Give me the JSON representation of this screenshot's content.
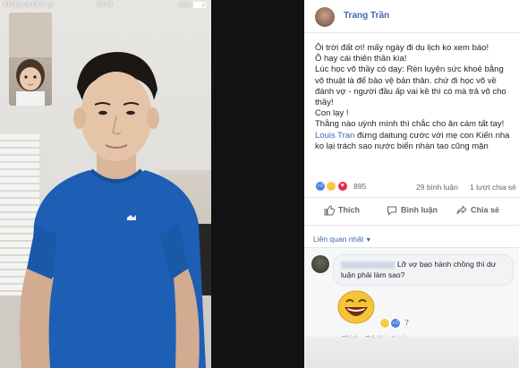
{
  "phone": {
    "carrier": "Không có Dịch vụ",
    "time": "09:46",
    "battery": "80%"
  },
  "post": {
    "author": "Trang Trần",
    "lines": [
      "Ôi trời đất ơi! mấy ngày đi du lịch ko xem báo!",
      "Ô hay cái thiên thần kìa!",
      "Lúc học võ thầy có dạy: Rèn luyện sức khoẻ bằng võ thuật là để bảo vệ bản thân. chứ đi học võ về đánh vợ - người đầu ấp vai kề thì có mà trả võ cho thầy!",
      "Con lạy !",
      "Thằng nào uỳnh mình thì chắc cho ăn cám tất tay!"
    ],
    "mention": "Louis Tran",
    "mention_rest": " đừng daitung cước với mẹ con Kiến nha ko lại trách sao nước biển nhàn tao cũng mặn",
    "reaction_count": "895",
    "comment_count": "29 bình luận",
    "share_count": "1 lượt chia sẻ",
    "actions": {
      "like": "Thích",
      "comment": "Bình luận",
      "share": "Chia sẻ"
    },
    "related_label": "Liên quan nhất"
  },
  "comment": {
    "text": "Lỡ vợ bạo hành chồng thì dư luận phải làm sao?",
    "reaction_count": "7",
    "actions": [
      "Thích",
      "Trả lời",
      "5 giờ"
    ]
  },
  "colors": {
    "facebook_blue": "#4267b2",
    "shirt_blue": "#1c5fb5"
  }
}
